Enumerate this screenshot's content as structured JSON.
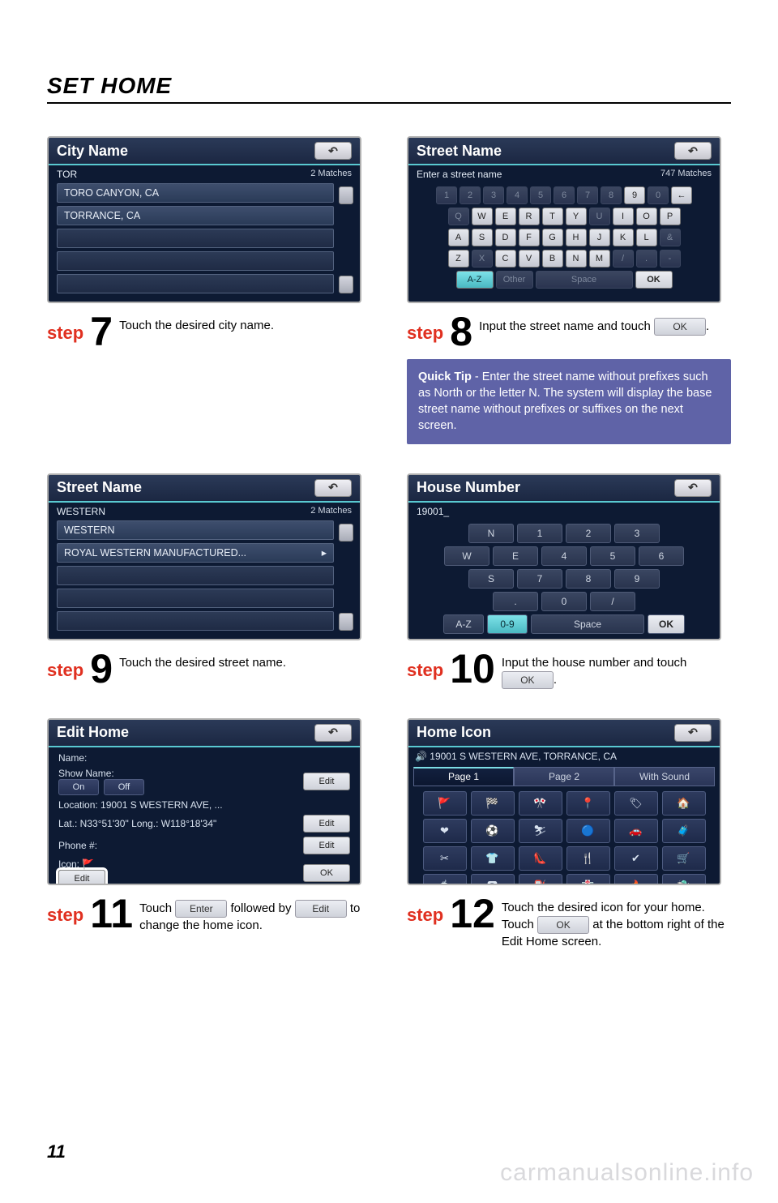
{
  "page_title": "SET HOME",
  "page_number": "11",
  "watermark": "carmanualsonline.info",
  "s7": {
    "title": "City Name",
    "input": "TOR",
    "matches": "2 Matches",
    "rows": [
      "TORO CANYON, CA",
      "TORRANCE, CA"
    ],
    "step": "7",
    "desc": "Touch the desired city name."
  },
  "s8": {
    "title": "Street Name",
    "prompt": "Enter a street name",
    "matches": "747 Matches",
    "row1": [
      "1",
      "2",
      "3",
      "4",
      "5",
      "6",
      "7",
      "8",
      "9",
      "0",
      "←"
    ],
    "row2": [
      "Q",
      "W",
      "E",
      "R",
      "T",
      "Y",
      "U",
      "I",
      "O",
      "P"
    ],
    "row3": [
      "A",
      "S",
      "D",
      "F",
      "G",
      "H",
      "J",
      "K",
      "L",
      "&"
    ],
    "row4": [
      "Z",
      "X",
      "C",
      "V",
      "B",
      "N",
      "M",
      "/",
      ".",
      "-"
    ],
    "az": "A-Z",
    "other": "Other",
    "space": "Space",
    "ok": "OK",
    "step": "8",
    "desc_a": "Input the street name and touch ",
    "desc_b": ".",
    "tip": "Quick Tip - Enter the street name without prefixes such as North or the letter N.  The system will display the base street name without prefixes or suffixes on the next screen."
  },
  "s9": {
    "title": "Street Name",
    "input": "WESTERN",
    "matches": "2 Matches",
    "rows": [
      "WESTERN",
      "ROYAL WESTERN MANUFACTURED..."
    ],
    "step": "9",
    "desc": "Touch the desired street name."
  },
  "s10": {
    "title": "House Number",
    "input": "19001_",
    "pad": [
      [
        "N",
        "1",
        "2",
        "3"
      ],
      [
        "W",
        "E",
        "4",
        "5",
        "6"
      ],
      [
        "S",
        "7",
        "8",
        "9"
      ],
      [
        ".",
        "0",
        "/"
      ]
    ],
    "az": "A-Z",
    "zero9": "0-9",
    "space": "Space",
    "ok": "OK",
    "step": "10",
    "desc_a": "Input the house number and touch ",
    "desc_b": "."
  },
  "s11": {
    "title": "Edit Home",
    "name": "Name:",
    "show": "Show Name:",
    "on": "On",
    "off": "Off",
    "edit": "Edit",
    "loc": "Location: 19001 S WESTERN AVE, ...",
    "lat": "Lat.: N33°51'30\"  Long.: W118°18'34\"",
    "phone": "Phone #:",
    "icon": "Icon:",
    "ok": "OK",
    "step": "11",
    "desc_a": "Touch ",
    "enter": "Enter",
    "desc_b": " followed by ",
    "desc_c": " to change the home icon."
  },
  "s12": {
    "title": "Home Icon",
    "addr": "19001 S WESTERN AVE, TORRANCE, CA",
    "tabs": [
      "Page 1",
      "Page 2",
      "With Sound"
    ],
    "step": "12",
    "desc_a": "Touch the desired icon for your home. Touch ",
    "ok": "OK",
    "desc_b": " at the bottom right of the Edit Home screen."
  }
}
